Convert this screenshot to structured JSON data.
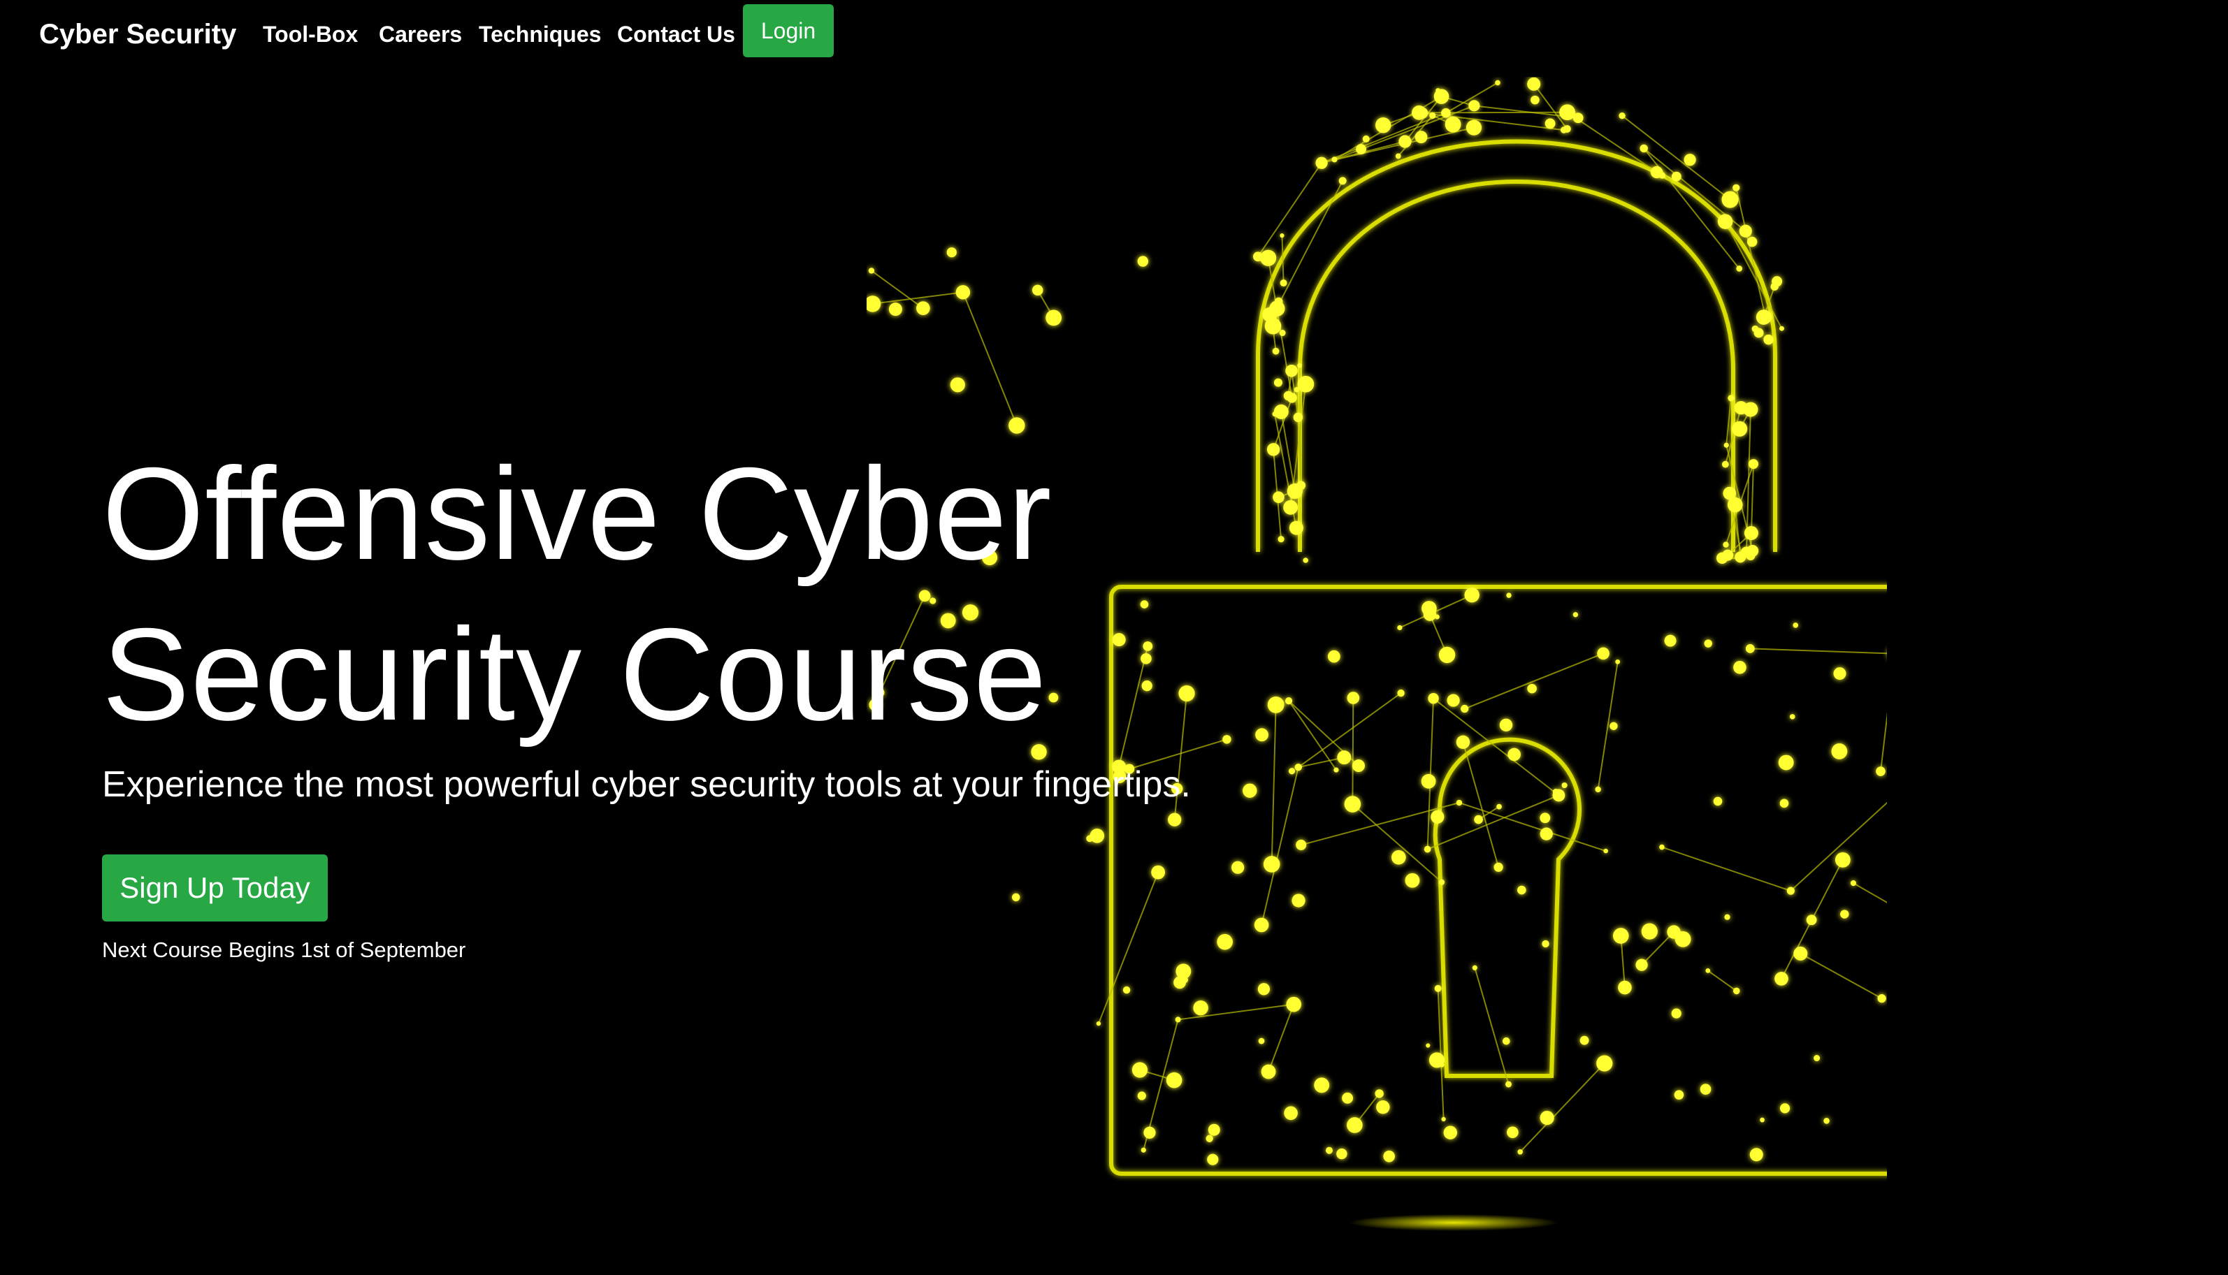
{
  "nav": {
    "brand": "Cyber Security",
    "links": [
      "Tool-Box",
      "Careers",
      "Techniques",
      "Contact Us"
    ],
    "login_label": "Login"
  },
  "hero": {
    "title_line1": "Offensive Cyber",
    "title_line2": "Security Course",
    "subtitle": "Experience the most powerful cyber security tools at your fingertips.",
    "cta_label": "Sign Up Today",
    "note": "Next Course Begins 1st of September",
    "image_icon": "padlock-network-icon"
  },
  "colors": {
    "background": "#000000",
    "text": "#ffffff",
    "button_green": "#28a745",
    "accent_yellow": "#ffff00"
  }
}
